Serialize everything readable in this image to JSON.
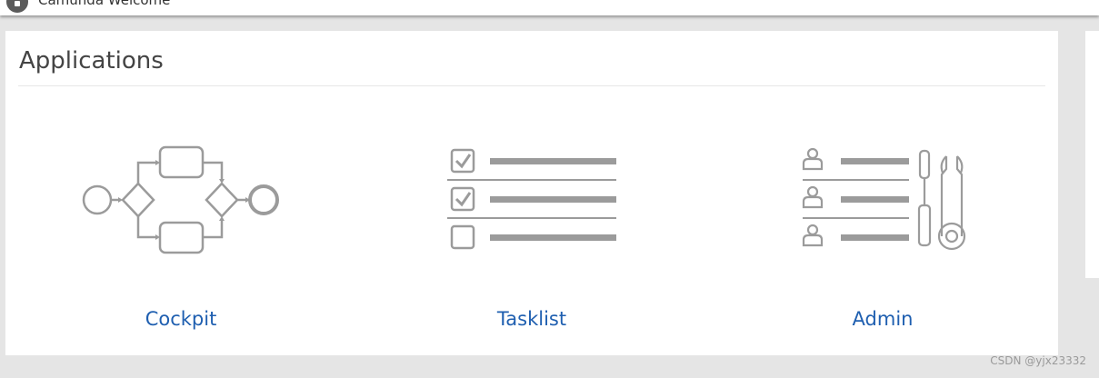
{
  "topbar": {
    "brand": "Camunda Welcome",
    "logo_icon": "camunda-logo-icon"
  },
  "panel": {
    "title": "Applications"
  },
  "apps": [
    {
      "label": "Cockpit",
      "icon": "bpmn-process-icon"
    },
    {
      "label": "Tasklist",
      "icon": "checklist-icon"
    },
    {
      "label": "Admin",
      "icon": "users-tools-icon"
    }
  ],
  "watermark": "CSDN @yjx23332",
  "colors": {
    "icon_gray": "#9b9b9b",
    "link_blue": "#1f5fb0",
    "page_bg": "#e5e5e5"
  }
}
